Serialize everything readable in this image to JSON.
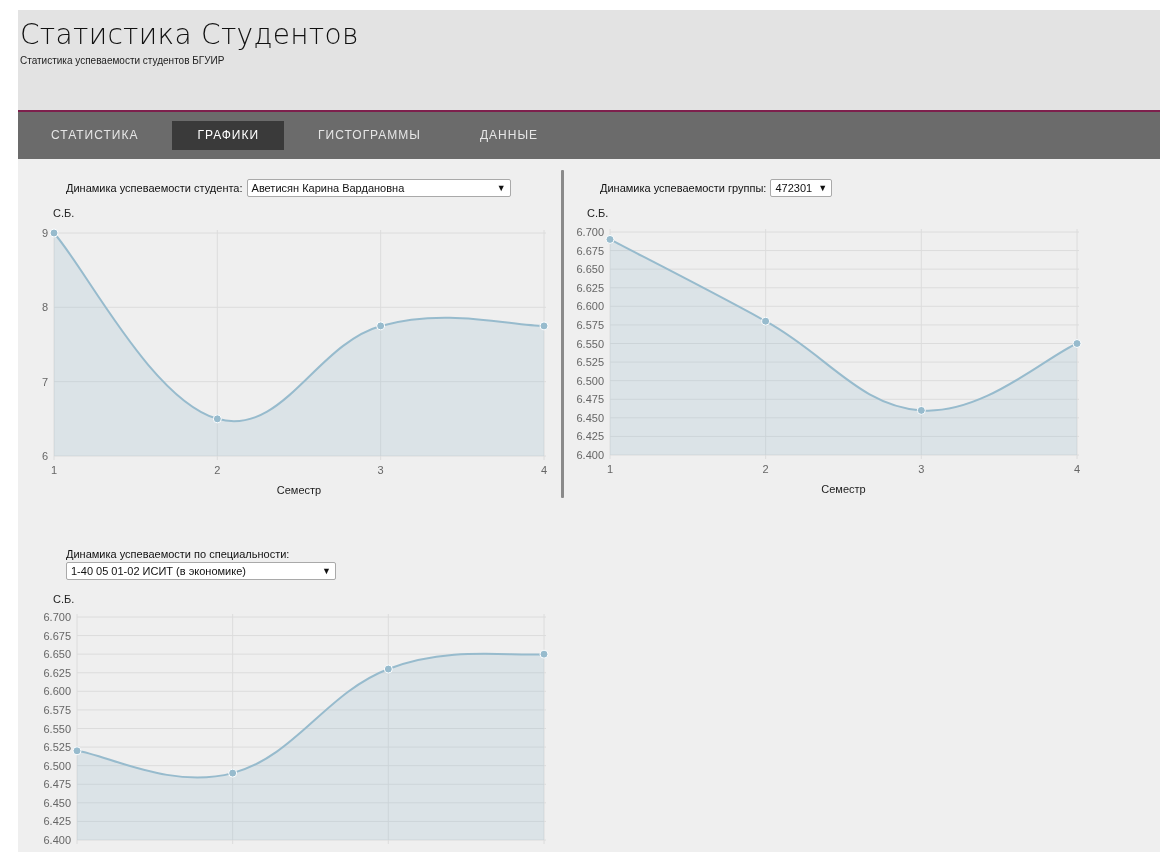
{
  "header": {
    "title": "Статистика Студентов",
    "subtitle": "Статистика успеваемости студентов БГУИР"
  },
  "tabs": [
    {
      "label": "СТАТИСТИКА",
      "selected": false
    },
    {
      "label": "ГРАФИКИ",
      "selected": true
    },
    {
      "label": "ГИСТОГРАММЫ",
      "selected": false
    },
    {
      "label": "ДАННЫЕ",
      "selected": false
    }
  ],
  "panels": [
    {
      "label": "Динамика успеваемости студента:",
      "select": "Аветисян Карина Вардановна",
      "select_arrow": "▼",
      "chart_data": {
        "type": "area",
        "ylabel": "С.Б.",
        "xlabel": "Семестр",
        "categories": [
          "1",
          "2",
          "3",
          "4"
        ],
        "grid": true,
        "series": [
          {
            "color": "#97bbcd",
            "values": [
              9,
              6.5,
              7.75,
              7.75
            ]
          }
        ],
        "ylim": [
          6,
          9
        ],
        "yticks": [
          6,
          7,
          8,
          9
        ]
      }
    },
    {
      "label": "Динамика успеваемости группы:",
      "select": "472301",
      "select_arrow": "▼",
      "chart_data": {
        "type": "area",
        "ylabel": "С.Б.",
        "xlabel": "Семестр",
        "categories": [
          "1",
          "2",
          "3",
          "4"
        ],
        "grid": true,
        "series": [
          {
            "color": "#97bbcd",
            "values": [
              6.69,
              6.58,
              6.46,
              6.55
            ]
          }
        ],
        "ylim": [
          6.4,
          6.7
        ],
        "yticks": [
          {
            "value": 6.4,
            "label": "6.400"
          },
          {
            "value": 6.425,
            "label": "6.425"
          },
          {
            "value": 6.45,
            "label": "6.450"
          },
          {
            "value": 6.475,
            "label": "6.475"
          },
          {
            "value": 6.5,
            "label": "6.500"
          },
          {
            "value": 6.525,
            "label": "6.525"
          },
          {
            "value": 6.55,
            "label": "6.550"
          },
          {
            "value": 6.575,
            "label": "6.575"
          },
          {
            "value": 6.6,
            "label": "6.600"
          },
          {
            "value": 6.625,
            "label": "6.625"
          },
          {
            "value": 6.65,
            "label": "6.650"
          },
          {
            "value": 6.675,
            "label": "6.675"
          },
          {
            "value": 6.7,
            "label": "6.700"
          }
        ]
      }
    },
    {
      "label": "Динамика успеваемости по специальности:",
      "select": "1-40 05 01-02 ИСИТ (в экономике)",
      "select_arrow": "▼",
      "chart_data": {
        "type": "area",
        "ylabel": "С.Б.",
        "grid": true,
        "series": [
          {
            "color": "#97bbcd",
            "values": [
              6.52,
              6.49,
              6.63,
              6.65
            ]
          }
        ],
        "ylim": [
          6.4,
          6.7
        ],
        "yticks": [
          {
            "value": 6.4,
            "label": "6.400"
          },
          {
            "value": 6.425,
            "label": "6.425"
          },
          {
            "value": 6.45,
            "label": "6.450"
          },
          {
            "value": 6.475,
            "label": "6.475"
          },
          {
            "value": 6.5,
            "label": "6.500"
          },
          {
            "value": 6.525,
            "label": "6.525"
          },
          {
            "value": 6.55,
            "label": "6.550"
          },
          {
            "value": 6.575,
            "label": "6.575"
          },
          {
            "value": 6.6,
            "label": "6.600"
          },
          {
            "value": 6.625,
            "label": "6.625"
          },
          {
            "value": 6.65,
            "label": "6.650"
          },
          {
            "value": 6.675,
            "label": "6.675"
          },
          {
            "value": 6.7,
            "label": "6.700"
          }
        ]
      }
    }
  ]
}
